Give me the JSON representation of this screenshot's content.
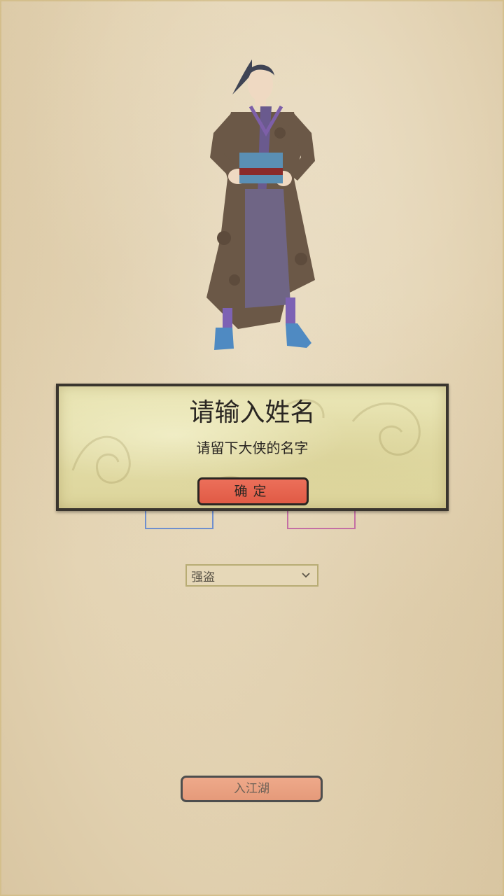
{
  "character": {
    "icon": "swordsman-character-portrait"
  },
  "gender": {
    "male_label": "",
    "female_label": ""
  },
  "class_select": {
    "selected": "强盗",
    "icon": "chevron-down-icon"
  },
  "enter_button": {
    "label": "入江湖"
  },
  "dialog": {
    "title": "请输入姓名",
    "message": "请留下大侠的名字",
    "confirm_label": "确定"
  },
  "colors": {
    "paper_bg": "#e4d4b4",
    "dialog_bg": "#e2dca6",
    "confirm_red": "#e05a45",
    "enter_salmon": "#e59a7a",
    "male_blue": "#6f8fce",
    "female_pink": "#c46fa4"
  }
}
